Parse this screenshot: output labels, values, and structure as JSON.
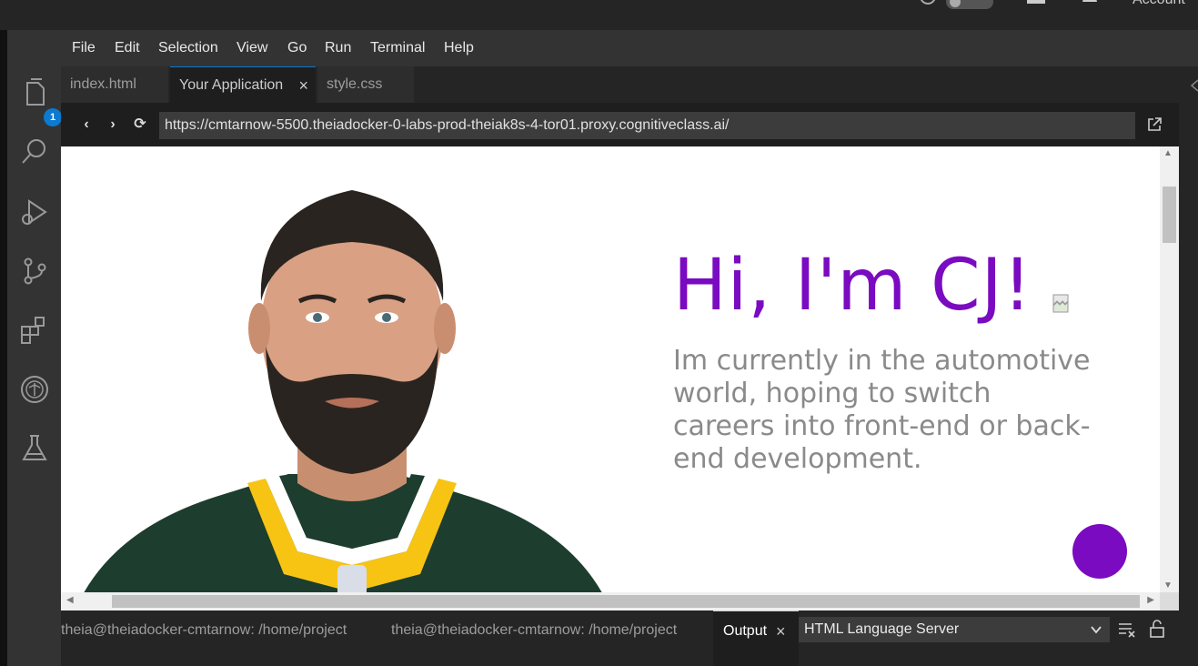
{
  "topbar": {
    "account_label": "Account",
    "icons": [
      "theme-icon",
      "toggle",
      "cloud-icon",
      "bell-icon"
    ]
  },
  "menu": {
    "items": [
      "File",
      "Edit",
      "Selection",
      "View",
      "Go",
      "Run",
      "Terminal",
      "Help"
    ]
  },
  "activity": {
    "explorer_badge": "1",
    "icons": [
      "files-icon",
      "search-icon",
      "debug-icon",
      "source-control-icon",
      "extensions-icon",
      "skills-network-icon",
      "flask-icon"
    ]
  },
  "tabs": [
    {
      "label": "index.html",
      "active": false
    },
    {
      "label": "Your Application",
      "active": true,
      "close": "×"
    },
    {
      "label": "style.css",
      "active": false
    }
  ],
  "browser": {
    "url": "https://cmtarnow-5500.theiadocker-0-labs-prod-theiak8s-4-tor01.proxy.cognitiveclass.ai/",
    "back": "‹",
    "forward": "›",
    "reload": "⟳"
  },
  "page": {
    "title": "Hi, I'm CJ!",
    "intro": "Im currently in the automotive world, hoping to switch careers into front-end or back-end development.",
    "accent_color": "#7a0bc0",
    "text_color": "#8a8a8a"
  },
  "panel": {
    "terminal_1": "theia@theiadocker-cmtarnow: /home/project",
    "terminal_2": "theia@theiadocker-cmtarnow: /home/project",
    "output_label": "Output",
    "output_close": "×",
    "channel_selected": "HTML Language Server"
  }
}
